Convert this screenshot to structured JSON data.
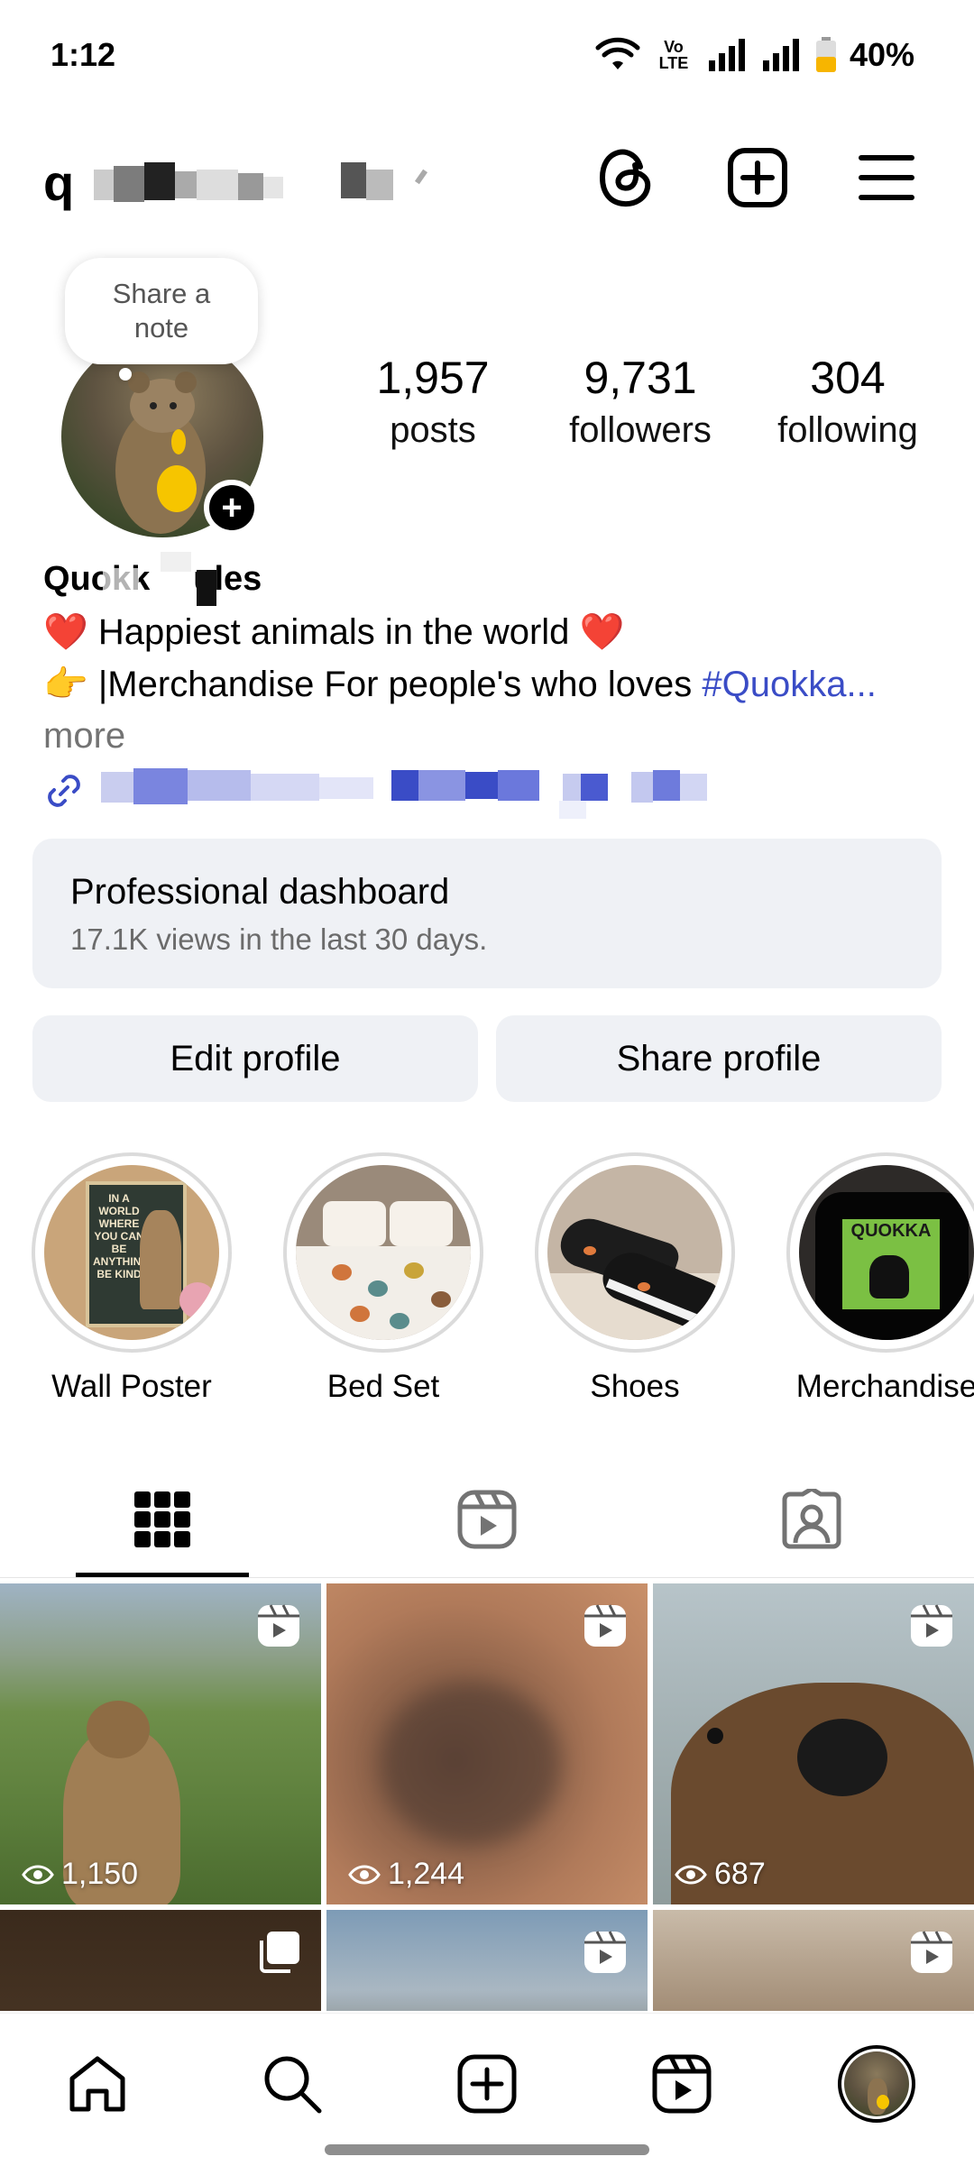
{
  "status_bar": {
    "time": "1:12",
    "battery": "40%",
    "volte": "Vo LTE"
  },
  "header": {
    "username": "q"
  },
  "note": {
    "text": "Share a note"
  },
  "stats": [
    {
      "value": "1,957",
      "label": "posts"
    },
    {
      "value": "9,731",
      "label": "followers"
    },
    {
      "value": "304",
      "label": "following"
    }
  ],
  "bio": {
    "name_visible_start": "Quokk",
    "name_visible_end": "ules",
    "line1": "❤️ Happiest animals in the world ❤️",
    "line2_text": "👉 |Merchandise For people's who loves ",
    "line2_tag": "#Quokka...",
    "more": "more"
  },
  "dashboard": {
    "title": "Professional dashboard",
    "subtitle": "17.1K views in the last 30 days."
  },
  "buttons": {
    "edit": "Edit profile",
    "share": "Share profile"
  },
  "highlights": [
    {
      "label": "Wall Poster"
    },
    {
      "label": "Bed Set"
    },
    {
      "label": "Shoes"
    },
    {
      "label": "Merchandise"
    }
  ],
  "poster_text": "IN A WORLD WHERE YOU CAN BE ANYTHING BE KIND",
  "shirt_text": "QUOKKA",
  "grid": [
    {
      "views": "1,150",
      "type": "reel"
    },
    {
      "views": "1,244",
      "type": "reel"
    },
    {
      "views": "687",
      "type": "reel"
    },
    {
      "views": "",
      "type": "carousel"
    },
    {
      "views": "",
      "type": "reel"
    },
    {
      "views": "",
      "type": "reel"
    }
  ],
  "icons": {
    "threads": "threads-icon",
    "create": "plus-square-icon",
    "menu": "hamburger-menu-icon",
    "grid_tab": "grid-icon",
    "reels_tab": "reels-icon",
    "tagged_tab": "tagged-person-icon",
    "home": "home-icon",
    "search": "search-icon",
    "reels": "reels-icon",
    "profile": "profile-avatar"
  },
  "colors": {
    "accent_link": "#3a4cc6",
    "surface": "#eff1f5",
    "battery": "#f7b500"
  }
}
